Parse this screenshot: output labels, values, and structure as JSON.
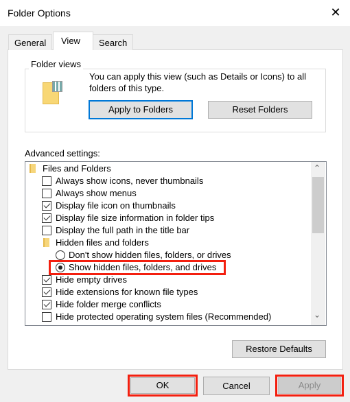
{
  "window": {
    "title": "Folder Options",
    "close_icon": "close-icon"
  },
  "tabs": [
    {
      "label": "General"
    },
    {
      "label": "View",
      "active": true
    },
    {
      "label": "Search"
    }
  ],
  "folder_views": {
    "label": "Folder views",
    "description_line1": "You can apply this view (such as Details or Icons) to all",
    "description_line2": "folders of this type.",
    "apply_button": "Apply to Folders",
    "reset_button": "Reset Folders"
  },
  "advanced": {
    "label": "Advanced settings:",
    "items": [
      {
        "type": "folder",
        "level": 0,
        "label": "Files and Folders"
      },
      {
        "type": "checkbox",
        "checked": false,
        "label": "Always show icons, never thumbnails"
      },
      {
        "type": "checkbox",
        "checked": false,
        "label": "Always show menus"
      },
      {
        "type": "checkbox",
        "checked": true,
        "label": "Display file icon on thumbnails"
      },
      {
        "type": "checkbox",
        "checked": true,
        "label": "Display file size information in folder tips"
      },
      {
        "type": "checkbox",
        "checked": false,
        "label": "Display the full path in the title bar"
      },
      {
        "type": "folder",
        "level": 1,
        "label": "Hidden files and folders"
      },
      {
        "type": "radio",
        "checked": false,
        "label": "Don't show hidden files, folders, or drives"
      },
      {
        "type": "radio",
        "checked": true,
        "highlighted": true,
        "label": "Show hidden files, folders, and drives"
      },
      {
        "type": "checkbox",
        "checked": true,
        "label": "Hide empty drives"
      },
      {
        "type": "checkbox",
        "checked": true,
        "label": "Hide extensions for known file types"
      },
      {
        "type": "checkbox",
        "checked": true,
        "label": "Hide folder merge conflicts"
      },
      {
        "type": "checkbox",
        "checked": false,
        "label": "Hide protected operating system files (Recommended)"
      }
    ],
    "restore_button": "Restore Defaults"
  },
  "footer": {
    "ok": "OK",
    "cancel": "Cancel",
    "apply": "Apply",
    "apply_disabled": true
  },
  "colors": {
    "highlight": "#f31f0f",
    "focus": "#0078d7"
  }
}
